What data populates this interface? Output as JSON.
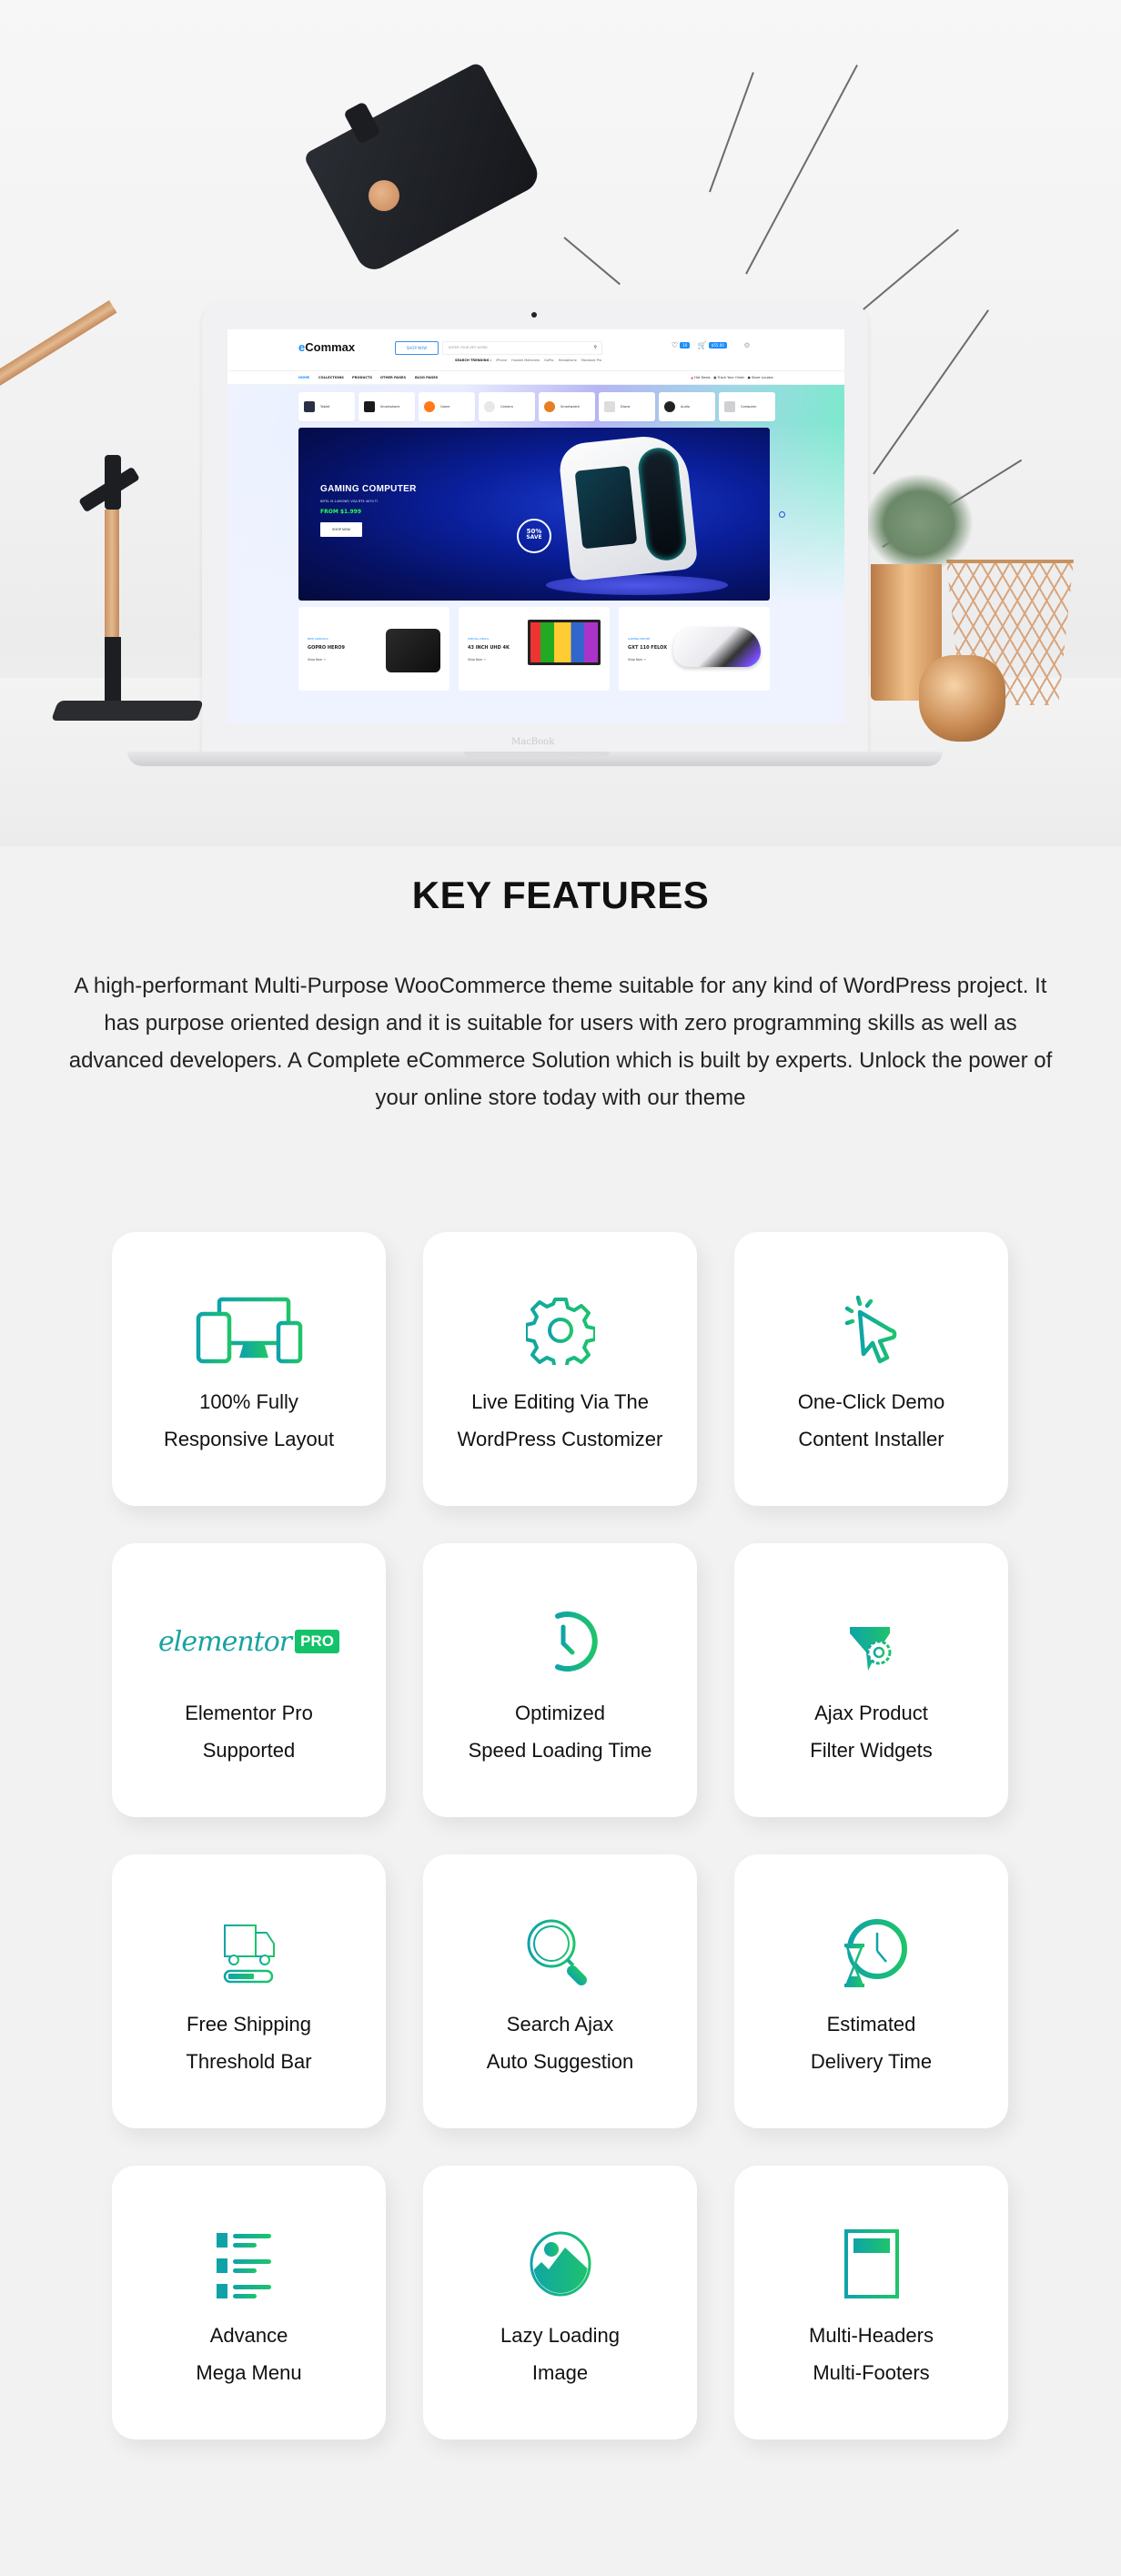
{
  "showcase": {
    "laptop_brand": "MacBook",
    "site": {
      "logo_prefix": "e",
      "logo_rest": "Commax",
      "shop_now_label": "SHOP NOW",
      "search_placeholder": "ENTER YOUR KEY WORD",
      "trending_label": "SEARCH TRENDING :",
      "trending_terms": [
        "iPhone",
        "Huawei Mateview",
        "GoPro",
        "Headphone",
        "Macbook Pro"
      ],
      "wishlist_count": "10",
      "cart_count": "0",
      "cart_total": "$55.00",
      "nav": [
        "HOME",
        "COLLECTIONS",
        "PRODUCTS",
        "OTHER PAGES",
        "BLOG PAGES"
      ],
      "nav_right": [
        "Hot Deals",
        "Track Your Order",
        "Store Locator"
      ],
      "categories": [
        {
          "label": "Tablet",
          "color": "#2b2f45"
        },
        {
          "label": "Smartphone",
          "color": "#1a1a1a"
        },
        {
          "label": "Game",
          "color": "#ff7a1a"
        },
        {
          "label": "Camera",
          "color": "#e8e8e8"
        },
        {
          "label": "Smartwatch",
          "color": "#e67e22"
        },
        {
          "label": "Drone",
          "color": "#dddddd"
        },
        {
          "label": "Audio",
          "color": "#222222"
        },
        {
          "label": "Computer",
          "color": "#cfcfd4"
        }
      ],
      "banner": {
        "title": "GAMING COMPUTER",
        "subtitle": "INTEL I9-14900KF/ VGA RTX 4070 TI",
        "price": "FROM $1.999",
        "button": "SHOP NOW",
        "save_percent": "50%",
        "save_label": "SAVE"
      },
      "promos": [
        {
          "tag": "NEW ARRIVALS",
          "name": "GOPRO HERO9",
          "link": "Shop Now →"
        },
        {
          "tag": "SPECIAL DEALS",
          "name": "43 INCH UHD 4K",
          "link": "Shop Now →"
        },
        {
          "tag": "GAMING MOUSE",
          "name": "GXT 110 FELOX",
          "link": "Shop Now →"
        }
      ]
    }
  },
  "key_features": {
    "title": "KEY FEATURES",
    "description": "A high-performant Multi-Purpose WooCommerce theme suitable for any kind of WordPress project. It has purpose oriented design and it is suitable for users with zero programming skills as well as advanced developers. A Complete eCommerce Solution which is built by experts. Unlock the power of your online store today with our theme",
    "accent_start": "#0fa3a8",
    "accent_end": "#1fc46a",
    "features": [
      {
        "icon": "devices-icon",
        "line1": "100% Fully",
        "line2": "Responsive Layout"
      },
      {
        "icon": "gear-icon",
        "line1": "Live Editing Via The",
        "line2": "WordPress Customizer"
      },
      {
        "icon": "click-cursor-icon",
        "line1": "One-Click Demo",
        "line2": "Content Installer"
      },
      {
        "icon": "elementor-pro-logo",
        "line1": "Elementor Pro",
        "line2": "Supported",
        "logo_text": "elementor",
        "logo_badge": "PRO"
      },
      {
        "icon": "speed-clock-icon",
        "line1": "Optimized",
        "line2": "Speed Loading Time"
      },
      {
        "icon": "filter-gear-icon",
        "line1": "Ajax Product",
        "line2": "Filter Widgets"
      },
      {
        "icon": "truck-progress-icon",
        "line1": "Free Shipping",
        "line2": "Threshold Bar"
      },
      {
        "icon": "magnifier-icon",
        "line1": "Search Ajax",
        "line2": "Auto Suggestion"
      },
      {
        "icon": "hourglass-clock-icon",
        "line1": "Estimated",
        "line2": "Delivery Time"
      },
      {
        "icon": "list-menu-icon",
        "line1": "Advance",
        "line2": "Mega Menu"
      },
      {
        "icon": "image-icon",
        "line1": "Lazy Loading",
        "line2": "Image"
      },
      {
        "icon": "document-layout-icon",
        "line1": "Multi-Headers",
        "line2": "Multi-Footers"
      }
    ]
  }
}
